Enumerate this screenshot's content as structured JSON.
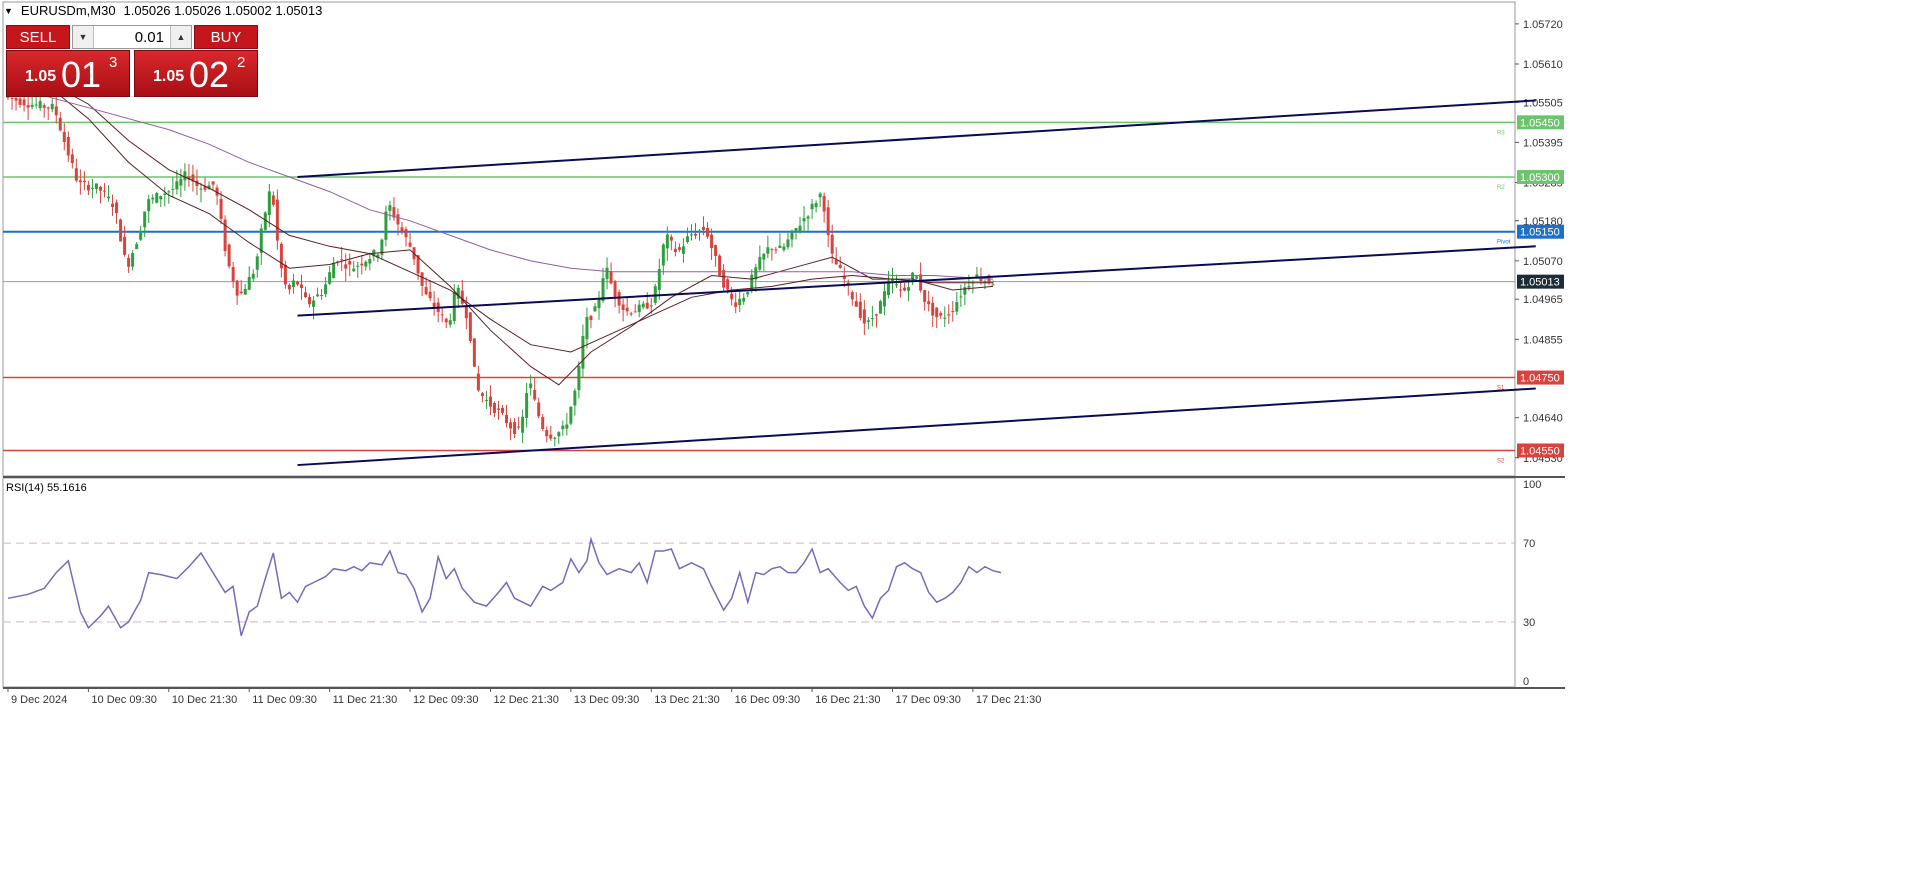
{
  "header": {
    "symbol_tf": "EURUSDm,M30",
    "ohlc": "1.05026 1.05026 1.05002 1.05013"
  },
  "trade_panel": {
    "sell_label": "SELL",
    "buy_label": "BUY",
    "lot_value": "0.01",
    "sell_price": {
      "small": "1.05",
      "big": "01",
      "sup": "3"
    },
    "buy_price": {
      "small": "1.05",
      "big": "02",
      "sup": "2"
    }
  },
  "colors": {
    "bull": "#2e9e3e",
    "bear": "#d9433d",
    "support": "#d9433d",
    "resistance": "#6cc56c",
    "pivot": "#1f6fc8",
    "current": "#1d2b36",
    "trendline": "#0a0a55",
    "ma_dark": "#5a1f24",
    "ma_purple": "#8e5fa5",
    "rsi": "#7a68b8",
    "rsi_level": "#d2b4d2",
    "axis_text": "#333333",
    "grid_border": "#999999"
  },
  "chart_data": [
    {
      "type": "candlestick",
      "symbol": "EURUSDm",
      "timeframe": "M30",
      "ylim": [
        1.0448,
        1.0578
      ],
      "xlim": [
        0,
        245
      ],
      "bars": 245,
      "y_ticks": [
        "1.05720",
        "1.05610",
        "1.05505",
        "1.05395",
        "1.05285",
        "1.05180",
        "1.05070",
        "1.04965",
        "1.04855",
        "1.04640",
        "1.04530"
      ],
      "y_tick_values": [
        1.0572,
        1.0561,
        1.05505,
        1.05395,
        1.05285,
        1.0518,
        1.0507,
        1.04965,
        1.04855,
        1.0464,
        1.0453
      ],
      "x_ticks": [
        {
          "bar": 0,
          "label": "9 Dec 2024"
        },
        {
          "bar": 20,
          "label": "10 Dec 09:30"
        },
        {
          "bar": 40,
          "label": "10 Dec 21:30"
        },
        {
          "bar": 60,
          "label": "11 Dec 09:30"
        },
        {
          "bar": 80,
          "label": "11 Dec 21:30"
        },
        {
          "bar": 100,
          "label": "12 Dec 09:30"
        },
        {
          "bar": 120,
          "label": "12 Dec 21:30"
        },
        {
          "bar": 140,
          "label": "13 Dec 09:30"
        },
        {
          "bar": 160,
          "label": "13 Dec 21:30"
        },
        {
          "bar": 180,
          "label": "16 Dec 09:30"
        },
        {
          "bar": 200,
          "label": "16 Dec 21:30"
        },
        {
          "bar": 220,
          "label": "17 Dec 09:30"
        },
        {
          "bar": 240,
          "label": "17 Dec 21:30"
        }
      ],
      "levels": [
        {
          "price": 1.0545,
          "label": "1.05450",
          "tag": "R3",
          "role": "resistance"
        },
        {
          "price": 1.053,
          "label": "1.05300",
          "tag": "R2",
          "role": "resistance"
        },
        {
          "price": 1.0515,
          "label": "1.05150",
          "tag": "Pivot",
          "role": "pivot"
        },
        {
          "price": 1.0475,
          "label": "1.04750",
          "tag": "S1",
          "role": "support"
        },
        {
          "price": 1.0455,
          "label": "1.04550",
          "tag": "S2",
          "role": "support"
        }
      ],
      "current_price": {
        "price": 1.05013,
        "label": "1.05013"
      },
      "trendlines": [
        {
          "x1": 72,
          "y1": 1.053,
          "x2": 380,
          "y2": 1.0551
        },
        {
          "x1": 72,
          "y1": 1.0492,
          "x2": 380,
          "y2": 1.0511
        },
        {
          "x1": 72,
          "y1": 1.0451,
          "x2": 380,
          "y2": 1.0472
        }
      ],
      "path": [
        [
          0,
          1.0552
        ],
        [
          6,
          1.055
        ],
        [
          12,
          1.0549
        ],
        [
          15,
          1.0538
        ],
        [
          18,
          1.0528
        ],
        [
          23,
          1.0527
        ],
        [
          27,
          1.0522
        ],
        [
          30,
          1.0505
        ],
        [
          33,
          1.0514
        ],
        [
          35,
          1.0523
        ],
        [
          38,
          1.0525
        ],
        [
          42,
          1.0527
        ],
        [
          45,
          1.0531
        ],
        [
          48,
          1.0527
        ],
        [
          52,
          1.0528
        ],
        [
          55,
          1.0507
        ],
        [
          58,
          1.0497
        ],
        [
          62,
          1.0505
        ],
        [
          64,
          1.0518
        ],
        [
          66,
          1.0528
        ],
        [
          68,
          1.0507
        ],
        [
          70,
          1.0498
        ],
        [
          72,
          1.0502
        ],
        [
          75,
          1.0495
        ],
        [
          79,
          1.0499
        ],
        [
          82,
          1.0508
        ],
        [
          86,
          1.0505
        ],
        [
          89,
          1.0507
        ],
        [
          93,
          1.051
        ],
        [
          95,
          1.0523
        ],
        [
          98,
          1.0516
        ],
        [
          101,
          1.051
        ],
        [
          104,
          1.0498
        ],
        [
          107,
          1.0494
        ],
        [
          110,
          1.0489
        ],
        [
          112,
          1.05
        ],
        [
          115,
          1.0491
        ],
        [
          117,
          1.0472
        ],
        [
          120,
          1.0468
        ],
        [
          123,
          1.0465
        ],
        [
          126,
          1.0461
        ],
        [
          128,
          1.046
        ],
        [
          130,
          1.0475
        ],
        [
          132,
          1.0466
        ],
        [
          134,
          1.046
        ],
        [
          136,
          1.0459
        ],
        [
          139,
          1.0461
        ],
        [
          142,
          1.0473
        ],
        [
          144,
          1.049
        ],
        [
          147,
          1.0494
        ],
        [
          149,
          1.0506
        ],
        [
          151,
          1.0499
        ],
        [
          154,
          1.0493
        ],
        [
          158,
          1.0494
        ],
        [
          161,
          1.0496
        ],
        [
          164,
          1.0514
        ],
        [
          167,
          1.0509
        ],
        [
          170,
          1.0514
        ],
        [
          174,
          1.0516
        ],
        [
          178,
          1.0502
        ],
        [
          181,
          1.0495
        ],
        [
          184,
          1.0498
        ],
        [
          187,
          1.0506
        ],
        [
          190,
          1.0511
        ],
        [
          193,
          1.051
        ],
        [
          196,
          1.0515
        ],
        [
          200,
          1.0521
        ],
        [
          203,
          1.0526
        ],
        [
          205,
          1.0509
        ],
        [
          208,
          1.0503
        ],
        [
          211,
          1.0496
        ],
        [
          214,
          1.0489
        ],
        [
          217,
          1.0494
        ],
        [
          220,
          1.0502
        ],
        [
          223,
          1.0498
        ],
        [
          226,
          1.0504
        ],
        [
          229,
          1.0495
        ],
        [
          232,
          1.0491
        ],
        [
          235,
          1.0493
        ],
        [
          238,
          1.0499
        ],
        [
          241,
          1.0503
        ],
        [
          243,
          1.0502
        ],
        [
          245,
          1.05013
        ]
      ],
      "moving_averages": [
        {
          "path": [
            [
              10,
              1.0555
            ],
            [
              20,
              1.0546
            ],
            [
              30,
              1.0534
            ],
            [
              40,
              1.0525
            ],
            [
              50,
              1.052
            ],
            [
              60,
              1.0512
            ],
            [
              70,
              1.0505
            ],
            [
              80,
              1.0506
            ],
            [
              90,
              1.0509
            ],
            [
              100,
              1.051
            ],
            [
              110,
              1.05
            ],
            [
              120,
              1.0488
            ],
            [
              130,
              1.0478
            ],
            [
              137,
              1.0473
            ],
            [
              145,
              1.0482
            ],
            [
              155,
              1.0489
            ],
            [
              165,
              1.0497
            ],
            [
              175,
              1.0503
            ],
            [
              185,
              1.0502
            ],
            [
              195,
              1.0505
            ],
            [
              205,
              1.0508
            ],
            [
              215,
              1.0502
            ],
            [
              225,
              1.0502
            ],
            [
              235,
              1.0499
            ],
            [
              245,
              1.05
            ]
          ]
        },
        {
          "path": [
            [
              10,
              1.0556
            ],
            [
              20,
              1.055
            ],
            [
              30,
              1.054
            ],
            [
              40,
              1.0532
            ],
            [
              50,
              1.0527
            ],
            [
              60,
              1.0521
            ],
            [
              70,
              1.0514
            ],
            [
              80,
              1.0511
            ],
            [
              90,
              1.0509
            ],
            [
              100,
              1.0504
            ],
            [
              110,
              1.0499
            ],
            [
              120,
              1.0491
            ],
            [
              130,
              1.0484
            ],
            [
              140,
              1.0482
            ],
            [
              150,
              1.0487
            ],
            [
              160,
              1.0492
            ],
            [
              170,
              1.0497
            ],
            [
              180,
              1.0499
            ],
            [
              190,
              1.05
            ],
            [
              200,
              1.0502
            ],
            [
              210,
              1.0503
            ],
            [
              220,
              1.0502
            ],
            [
              230,
              1.0501
            ],
            [
              245,
              1.0501
            ]
          ]
        },
        {
          "path": [
            [
              10,
              1.0552
            ],
            [
              20,
              1.0549
            ],
            [
              30,
              1.0546
            ],
            [
              40,
              1.0543
            ],
            [
              50,
              1.0539
            ],
            [
              60,
              1.0534
            ],
            [
              70,
              1.053
            ],
            [
              80,
              1.0526
            ],
            [
              90,
              1.0521
            ],
            [
              100,
              1.0518
            ],
            [
              110,
              1.0514
            ],
            [
              120,
              1.051
            ],
            [
              130,
              1.0507
            ],
            [
              140,
              1.0505
            ],
            [
              150,
              1.0504
            ],
            [
              160,
              1.0504
            ],
            [
              170,
              1.0504
            ],
            [
              180,
              1.0504
            ],
            [
              190,
              1.0504
            ],
            [
              200,
              1.0504
            ],
            [
              210,
              1.0504
            ],
            [
              220,
              1.0503
            ],
            [
              230,
              1.0503
            ],
            [
              245,
              1.0502
            ]
          ]
        }
      ]
    },
    {
      "type": "line",
      "title": "RSI(14) 55.1616",
      "ylim": [
        0,
        100
      ],
      "y_ticks": [
        "100",
        "70",
        "30",
        "0"
      ],
      "y_tick_values": [
        100,
        70,
        30,
        0
      ],
      "levels": [
        70,
        30
      ],
      "path": [
        [
          0,
          42
        ],
        [
          5,
          44
        ],
        [
          9,
          47
        ],
        [
          12,
          55
        ],
        [
          15,
          61
        ],
        [
          18,
          35
        ],
        [
          20,
          27
        ],
        [
          23,
          33
        ],
        [
          25,
          38
        ],
        [
          28,
          27
        ],
        [
          30,
          30
        ],
        [
          33,
          41
        ],
        [
          35,
          55
        ],
        [
          38,
          54
        ],
        [
          42,
          52
        ],
        [
          45,
          58
        ],
        [
          48,
          65
        ],
        [
          51,
          55
        ],
        [
          54,
          45
        ],
        [
          56,
          48
        ],
        [
          58,
          23
        ],
        [
          60,
          35
        ],
        [
          62,
          38
        ],
        [
          64,
          52
        ],
        [
          66,
          65
        ],
        [
          68,
          42
        ],
        [
          70,
          45
        ],
        [
          72,
          40
        ],
        [
          74,
          48
        ],
        [
          76,
          50
        ],
        [
          79,
          53
        ],
        [
          81,
          57
        ],
        [
          84,
          56
        ],
        [
          86,
          58
        ],
        [
          88,
          56
        ],
        [
          90,
          60
        ],
        [
          93,
          59
        ],
        [
          95,
          66
        ],
        [
          97,
          55
        ],
        [
          99,
          54
        ],
        [
          101,
          47
        ],
        [
          103,
          35
        ],
        [
          105,
          42
        ],
        [
          107,
          63
        ],
        [
          109,
          52
        ],
        [
          111,
          57
        ],
        [
          113,
          47
        ],
        [
          116,
          40
        ],
        [
          119,
          38
        ],
        [
          122,
          45
        ],
        [
          124,
          50
        ],
        [
          126,
          42
        ],
        [
          128,
          40
        ],
        [
          130,
          38
        ],
        [
          133,
          48
        ],
        [
          135,
          46
        ],
        [
          138,
          50
        ],
        [
          140,
          62
        ],
        [
          142,
          55
        ],
        [
          144,
          61
        ],
        [
          145,
          72
        ],
        [
          147,
          60
        ],
        [
          149,
          54
        ],
        [
          152,
          57
        ],
        [
          155,
          55
        ],
        [
          157,
          60
        ],
        [
          159,
          50
        ],
        [
          161,
          66
        ],
        [
          163,
          66
        ],
        [
          165,
          67
        ],
        [
          167,
          57
        ],
        [
          170,
          60
        ],
        [
          173,
          57
        ],
        [
          175,
          48
        ],
        [
          178,
          36
        ],
        [
          180,
          42
        ],
        [
          182,
          55
        ],
        [
          184,
          40
        ],
        [
          186,
          55
        ],
        [
          188,
          54
        ],
        [
          190,
          57
        ],
        [
          192,
          58
        ],
        [
          194,
          55
        ],
        [
          196,
          55
        ],
        [
          198,
          60
        ],
        [
          200,
          67
        ],
        [
          202,
          55
        ],
        [
          204,
          57
        ],
        [
          207,
          50
        ],
        [
          209,
          46
        ],
        [
          211,
          48
        ],
        [
          213,
          38
        ],
        [
          215,
          32
        ],
        [
          217,
          42
        ],
        [
          219,
          46
        ],
        [
          221,
          58
        ],
        [
          223,
          60
        ],
        [
          225,
          57
        ],
        [
          227,
          55
        ],
        [
          229,
          45
        ],
        [
          231,
          40
        ],
        [
          233,
          42
        ],
        [
          235,
          45
        ],
        [
          237,
          50
        ],
        [
          239,
          58
        ],
        [
          241,
          55
        ],
        [
          243,
          58
        ],
        [
          245,
          56
        ],
        [
          247,
          55
        ]
      ]
    }
  ]
}
